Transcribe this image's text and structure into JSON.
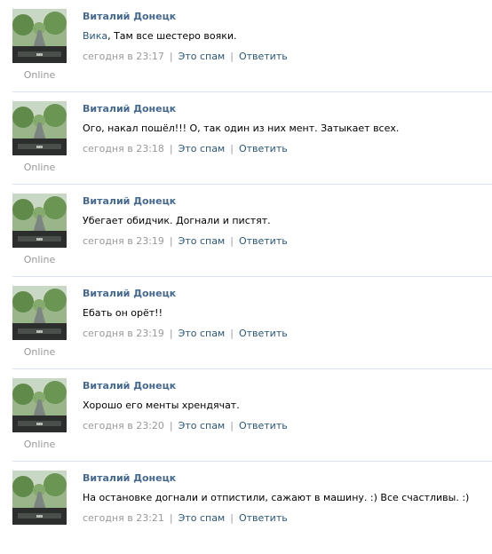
{
  "comments": [
    {
      "author": "Виталий Донецк",
      "mention": "Вика",
      "text": ", Там все шестеро вояки.",
      "date": "сегодня в 23:17",
      "spam_label": "Это спам",
      "reply_label": "Ответить",
      "status": "Online"
    },
    {
      "author": "Виталий Донецк",
      "text": "Ого, накал пошёл!!! О, так один из них мент. Затыкает всех.",
      "date": "сегодня в 23:18",
      "spam_label": "Это спам",
      "reply_label": "Ответить",
      "status": "Online"
    },
    {
      "author": "Виталий Донецк",
      "text": "Убегает обидчик. Догнали и пистят.",
      "date": "сегодня в 23:19",
      "spam_label": "Это спам",
      "reply_label": "Ответить",
      "status": "Online"
    },
    {
      "author": "Виталий Донецк",
      "text": "Ебать он орёт!!",
      "date": "сегодня в 23:19",
      "spam_label": "Это спам",
      "reply_label": "Ответить",
      "status": "Online"
    },
    {
      "author": "Виталий Донецк",
      "text": "Хорошо его менты хрендячат.",
      "date": "сегодня в 23:20",
      "spam_label": "Это спам",
      "reply_label": "Ответить",
      "status": "Online"
    },
    {
      "author": "Виталий Донецк",
      "text": "На остановке догнали и отпистили, сажают в машину. :) Все счастливы. :)",
      "date": "сегодня в 23:21",
      "spam_label": "Это спам",
      "reply_label": "Ответить"
    }
  ],
  "colors": {
    "author": "#45688e",
    "link": "#2b587a",
    "muted": "#999999",
    "divider": "#dae1e8"
  },
  "icons": {
    "avatar": "avatar-road-photo-icon"
  }
}
